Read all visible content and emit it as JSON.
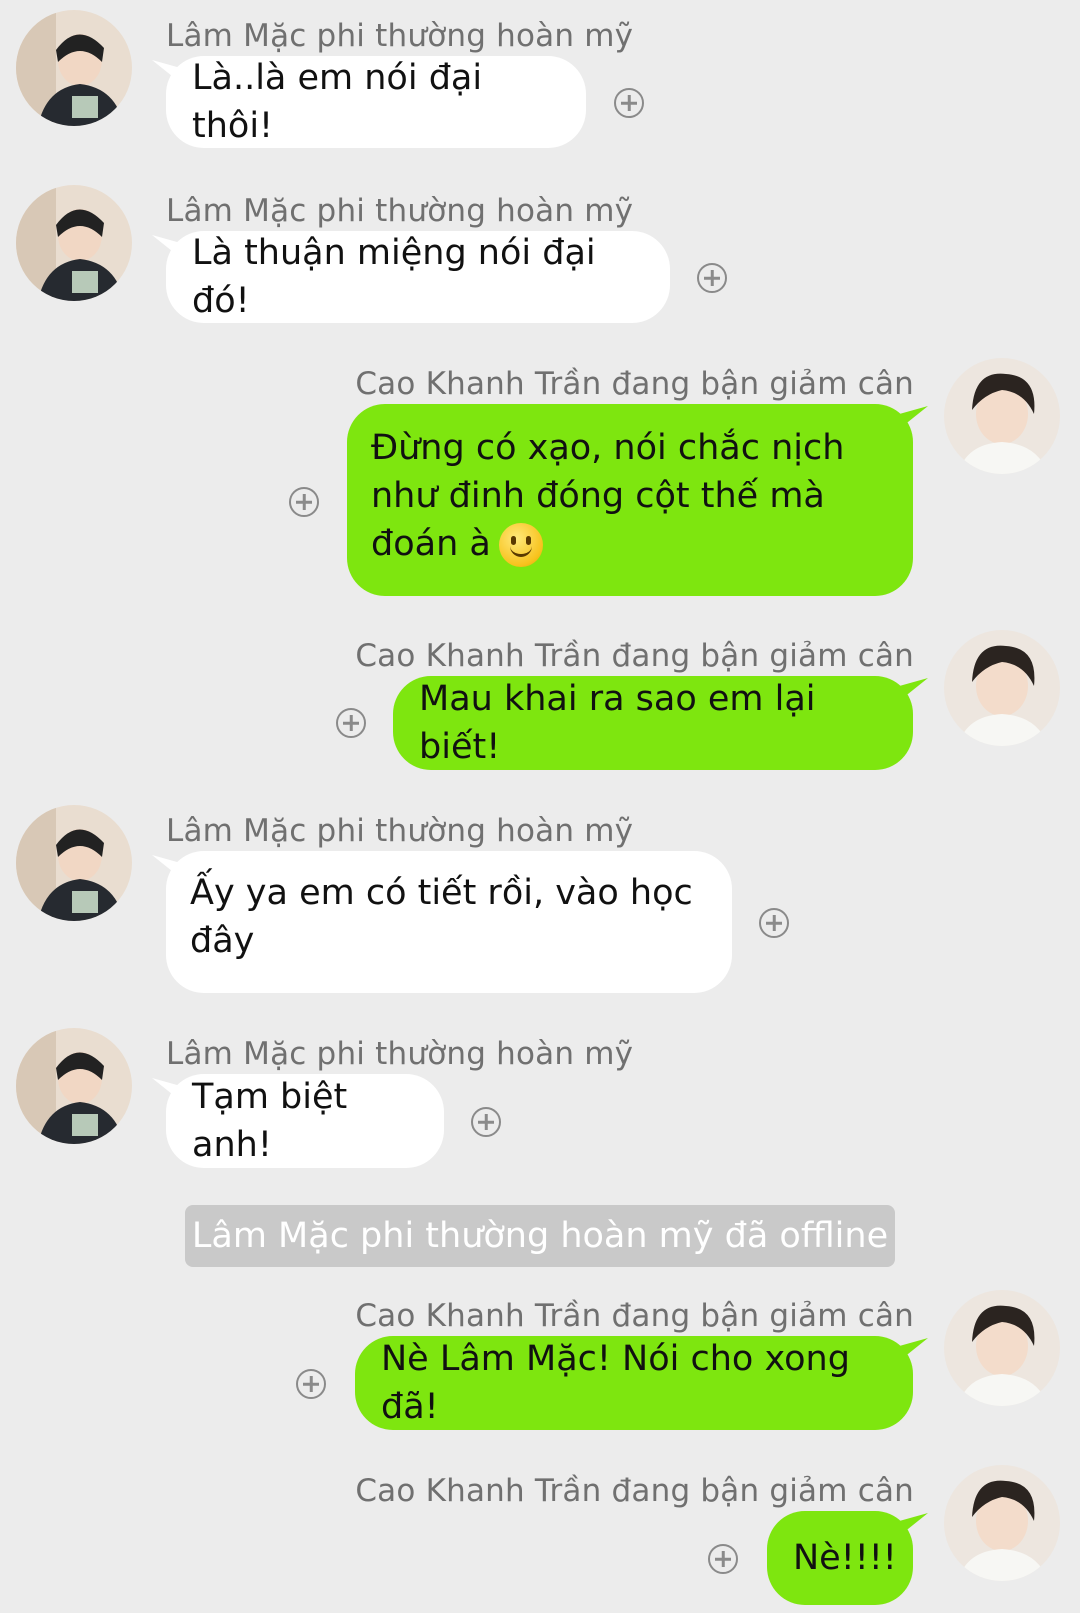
{
  "contacts": {
    "other": "Lâm Mặc phi thường hoàn mỹ",
    "self": "Cao Khanh Trần đang bận giảm cân"
  },
  "messages": [
    {
      "sender": "other",
      "text": "Là..là em nói đại thôi!"
    },
    {
      "sender": "other",
      "text": "Là thuận miệng nói đại đó!"
    },
    {
      "sender": "self",
      "text": "Đừng có xạo, nói chắc nịch như đinh đóng cột thế mà đoán à",
      "emoji": "smile-emoji"
    },
    {
      "sender": "self",
      "text": "Mau khai ra sao em lại biết!"
    },
    {
      "sender": "other",
      "text": "Ấy ya em có tiết rồi, vào học đây"
    },
    {
      "sender": "other",
      "text": "Tạm biệt anh!"
    },
    {
      "sender": "self",
      "text": "Nè Lâm Mặc! Nói cho xong đã!"
    },
    {
      "sender": "self",
      "text": "Nè!!!!"
    }
  ],
  "system_notice": "Lâm Mặc phi thường hoàn mỹ đã offline",
  "colors": {
    "background": "#ececec",
    "incoming_bubble": "#ffffff",
    "outgoing_bubble": "#7ee60f",
    "system_pill": "#c9c9c9"
  },
  "icons": {
    "reaction": "plus-circle-icon",
    "avatar_other": "avatar-boy-dark-hoodie",
    "avatar_self": "avatar-boy-white-shirt"
  }
}
